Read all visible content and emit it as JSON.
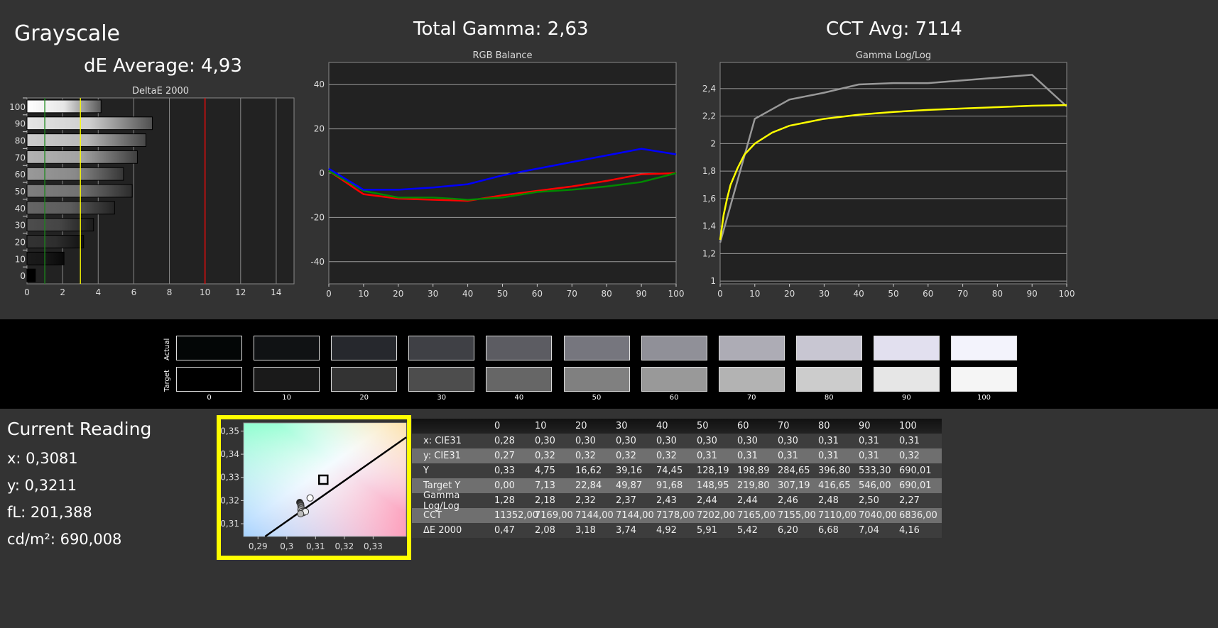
{
  "header": {
    "title": "Grayscale",
    "de_average": "dE Average: 4,93",
    "total_gamma": "Total Gamma: 2,63",
    "cct_avg": "CCT Avg: 7114"
  },
  "swatches": {
    "actual_label": "Actual",
    "target_label": "Target",
    "levels": [
      "0",
      "10",
      "20",
      "30",
      "40",
      "50",
      "60",
      "70",
      "80",
      "90",
      "100"
    ],
    "actual_colors": [
      "#030606",
      "#101214",
      "#26282d",
      "#3f4045",
      "#5c5c62",
      "#76767e",
      "#909098",
      "#adacb5",
      "#c8c6d2",
      "#e2e0ef",
      "#f3f3fc"
    ],
    "target_colors": [
      "#000000",
      "#1a1a1a",
      "#333333",
      "#4d4d4d",
      "#666666",
      "#808080",
      "#999999",
      "#b3b3b3",
      "#cccccc",
      "#e6e6e6",
      "#f5f5f5"
    ]
  },
  "current_reading": {
    "title": "Current Reading",
    "x": "x: 0,3081",
    "y": "y: 0,3211",
    "fl": "fL: 201,388",
    "cdm2": "cd/m²: 690,008"
  },
  "table": {
    "headers": [
      "",
      "0",
      "10",
      "20",
      "30",
      "40",
      "50",
      "60",
      "70",
      "80",
      "90",
      "100"
    ],
    "rows": [
      [
        "x: CIE31",
        "0,28",
        "0,30",
        "0,30",
        "0,30",
        "0,30",
        "0,30",
        "0,30",
        "0,30",
        "0,31",
        "0,31",
        "0,31"
      ],
      [
        "y: CIE31",
        "0,27",
        "0,32",
        "0,32",
        "0,32",
        "0,32",
        "0,31",
        "0,31",
        "0,31",
        "0,31",
        "0,31",
        "0,32"
      ],
      [
        "Y",
        "0,33",
        "4,75",
        "16,62",
        "39,16",
        "74,45",
        "128,19",
        "198,89",
        "284,65",
        "396,80",
        "533,30",
        "690,01"
      ],
      [
        "Target Y",
        "0,00",
        "7,13",
        "22,84",
        "49,87",
        "91,68",
        "148,95",
        "219,80",
        "307,19",
        "416,65",
        "546,00",
        "690,01"
      ],
      [
        "Gamma Log/Log",
        "1,28",
        "2,18",
        "2,32",
        "2,37",
        "2,43",
        "2,44",
        "2,44",
        "2,46",
        "2,48",
        "2,50",
        "2,27"
      ],
      [
        "CCT",
        "11352,00",
        "7169,00",
        "7144,00",
        "7144,00",
        "7178,00",
        "7202,00",
        "7165,00",
        "7155,00",
        "7110,00",
        "7040,00",
        "6836,00"
      ],
      [
        "ΔE 2000",
        "0,47",
        "2,08",
        "3,18",
        "3,74",
        "4,92",
        "5,91",
        "5,42",
        "6,20",
        "6,68",
        "7,04",
        "4,16"
      ]
    ]
  },
  "chart_data": [
    {
      "type": "bar",
      "title": "DeltaE 2000",
      "orientation": "horizontal",
      "categories": [
        "100",
        "90",
        "80",
        "70",
        "60",
        "50",
        "40",
        "30",
        "20",
        "10",
        "0"
      ],
      "values": [
        4.16,
        7.04,
        6.68,
        6.2,
        5.42,
        5.91,
        4.92,
        3.74,
        3.18,
        2.08,
        0.47
      ],
      "xlim": [
        0,
        15
      ],
      "xticks": [
        "0",
        "2",
        "4",
        "6",
        "8",
        "10",
        "12",
        "14"
      ],
      "reference_lines": [
        {
          "value": 1,
          "color": "#1a8a1a"
        },
        {
          "value": 3,
          "color": "#ffff00"
        },
        {
          "value": 10,
          "color": "#ff0000"
        }
      ],
      "grid": true
    },
    {
      "type": "line",
      "title": "RGB Balance",
      "x": [
        0,
        10,
        20,
        30,
        40,
        50,
        60,
        70,
        80,
        90,
        100
      ],
      "ylim": [
        -50,
        50
      ],
      "xticks": [
        "0",
        "10",
        "20",
        "30",
        "40",
        "50",
        "60",
        "70",
        "80",
        "90",
        "100"
      ],
      "yticks": [
        "40",
        "20",
        "0",
        "-20",
        "-40"
      ],
      "grid": true,
      "series": [
        {
          "color": "#ff0000",
          "values": [
            1,
            -9.5,
            -11.5,
            -12,
            -12.5,
            -10,
            -8,
            -6,
            -3.5,
            -0.5,
            0
          ]
        },
        {
          "color": "#008800",
          "values": [
            1,
            -8,
            -11,
            -11,
            -12,
            -11,
            -8.5,
            -7.5,
            -6,
            -4,
            0
          ]
        },
        {
          "color": "#0000ff",
          "values": [
            2,
            -7.5,
            -7.5,
            -6.5,
            -5,
            -1,
            2,
            5,
            8,
            11,
            8.5
          ]
        }
      ]
    },
    {
      "type": "line",
      "title": "Gamma Log/Log",
      "ylim": [
        0.98,
        2.59
      ],
      "xticks": [
        "0",
        "10",
        "20",
        "30",
        "40",
        "50",
        "60",
        "70",
        "80",
        "90",
        "100"
      ],
      "yticks": [
        "2,4",
        "2,2",
        "2",
        "1,8",
        "1,6",
        "1,4",
        "1,2",
        "1"
      ],
      "grid": true,
      "series": [
        {
          "color": "#999999",
          "x": [
            0,
            10,
            20,
            30,
            40,
            50,
            60,
            70,
            80,
            90,
            100
          ],
          "values": [
            1.28,
            2.18,
            2.32,
            2.37,
            2.43,
            2.44,
            2.44,
            2.46,
            2.48,
            2.5,
            2.27
          ]
        },
        {
          "color": "#ffff00",
          "x": [
            0,
            1,
            2,
            3,
            5,
            7,
            10,
            15,
            20,
            30,
            40,
            50,
            60,
            70,
            80,
            90,
            100
          ],
          "values": [
            1.3,
            1.48,
            1.6,
            1.7,
            1.82,
            1.92,
            2.0,
            2.08,
            2.13,
            2.18,
            2.21,
            2.23,
            2.245,
            2.255,
            2.265,
            2.275,
            2.28
          ]
        }
      ]
    },
    {
      "type": "scatter",
      "title": "",
      "xlim": [
        0.285,
        0.3415
      ],
      "ylim": [
        0.3045,
        0.3535
      ],
      "xticks": [
        "0,29",
        "0,3",
        "0,31",
        "0,32",
        "0,33"
      ],
      "yticks": [
        "0,35",
        "0,34",
        "0,33",
        "0,32",
        "0,31"
      ],
      "target": {
        "x": 0.3127,
        "y": 0.329
      },
      "points": [
        {
          "x": 0.3045,
          "y": 0.3192,
          "fill": "#222"
        },
        {
          "x": 0.3048,
          "y": 0.3185,
          "fill": "#444"
        },
        {
          "x": 0.3049,
          "y": 0.3178,
          "fill": "#666"
        },
        {
          "x": 0.305,
          "y": 0.3168,
          "fill": "#888"
        },
        {
          "x": 0.3049,
          "y": 0.316,
          "fill": "#aaa"
        },
        {
          "x": 0.3052,
          "y": 0.3152,
          "fill": "#ccc"
        },
        {
          "x": 0.3058,
          "y": 0.3148,
          "fill": "#ddd"
        },
        {
          "x": 0.3065,
          "y": 0.3152,
          "fill": "#eee"
        },
        {
          "x": 0.3048,
          "y": 0.3143,
          "fill": "#bbb"
        },
        {
          "x": 0.3081,
          "y": 0.3211,
          "fill": "#fff"
        }
      ],
      "locus": [
        [
          0.2925,
          0.3045
        ],
        [
          0.3415,
          0.3473
        ]
      ]
    }
  ]
}
